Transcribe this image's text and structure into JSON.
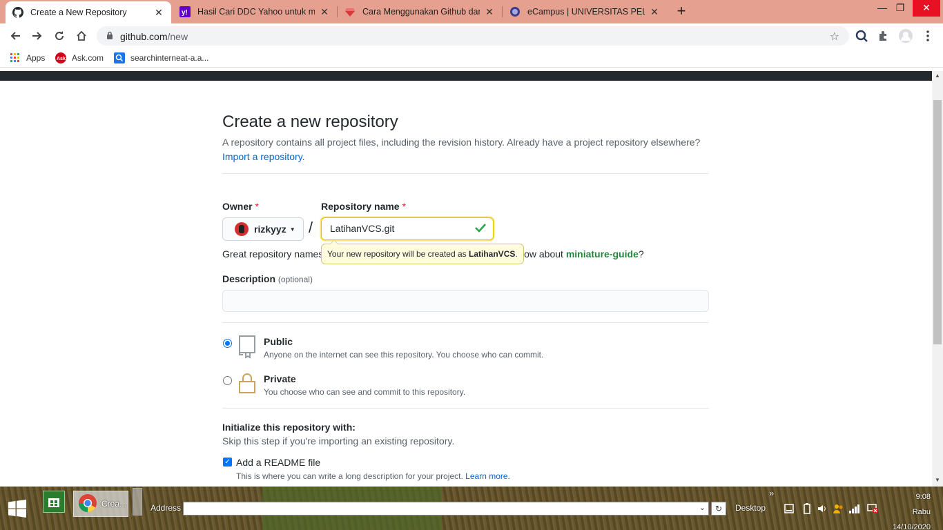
{
  "browser": {
    "tabs": [
      {
        "title": "Create a New Repository",
        "active": true,
        "icon": "github-icon"
      },
      {
        "title": "Hasil Cari DDC Yahoo untuk men",
        "active": false,
        "icon": "yahoo-icon"
      },
      {
        "title": "Cara Menggunakan Github dan M",
        "active": false,
        "icon": "ruby-icon"
      },
      {
        "title": "eCampus | UNIVERSITAS PELITA B",
        "active": false,
        "icon": "campus-icon"
      }
    ],
    "new_tab": "+",
    "url_host": "github.com",
    "url_path": "/new",
    "bookmarks": [
      {
        "label": "Apps",
        "icon": "apps-grid-icon"
      },
      {
        "label": "Ask.com",
        "icon": "ask-icon"
      },
      {
        "label": "searchinterneat-a.a...",
        "icon": "search-icon"
      }
    ]
  },
  "page": {
    "title": "Create a new repository",
    "subtitle": "A repository contains all project files, including the revision history. Already have a project repository elsewhere?",
    "import_link": "Import a repository.",
    "owner_label": "Owner",
    "required_mark": "*",
    "owner_value": "rizkyyz",
    "slash": "/",
    "repo_name_label": "Repository name",
    "repo_name_value": "LatihanVCS.git",
    "hint_prefix": "Great repository names",
    "hint_suffix": "How about",
    "hint_suggestion": "miniature-guide",
    "hint_end": "?",
    "tooltip_prefix": "Your new repository will be created as",
    "tooltip_name": "LatihanVCS",
    "tooltip_end": ".",
    "description_label": "Description",
    "description_optional": "(optional)",
    "description_value": "",
    "visibility": [
      {
        "title": "Public",
        "desc": "Anyone on the internet can see this repository. You choose who can commit.",
        "selected": true,
        "icon": "repo-icon"
      },
      {
        "title": "Private",
        "desc": "You choose who can see and commit to this repository.",
        "selected": false,
        "icon": "lock-icon"
      }
    ],
    "init_title": "Initialize this repository with:",
    "init_subtitle": "Skip this step if you're importing an existing repository.",
    "readme_label": "Add a README file",
    "readme_checked": true,
    "readme_desc": "This is where you can write a long description for your project.",
    "readme_learn": "Learn more."
  },
  "taskbar": {
    "chrome_label": "Crea...",
    "address_label": "Address",
    "desktop_label": "Desktop",
    "overflow": "»",
    "time": "9:08",
    "day": "Rabu",
    "date": "14/10/2020"
  },
  "colors": {
    "tabstrip": "#e5a08f",
    "link": "#0366d6",
    "suggestion": "#22863a",
    "required": "#cb2431",
    "tooltip_bg": "#fffbdd",
    "radio_accent": "#0075ff"
  }
}
